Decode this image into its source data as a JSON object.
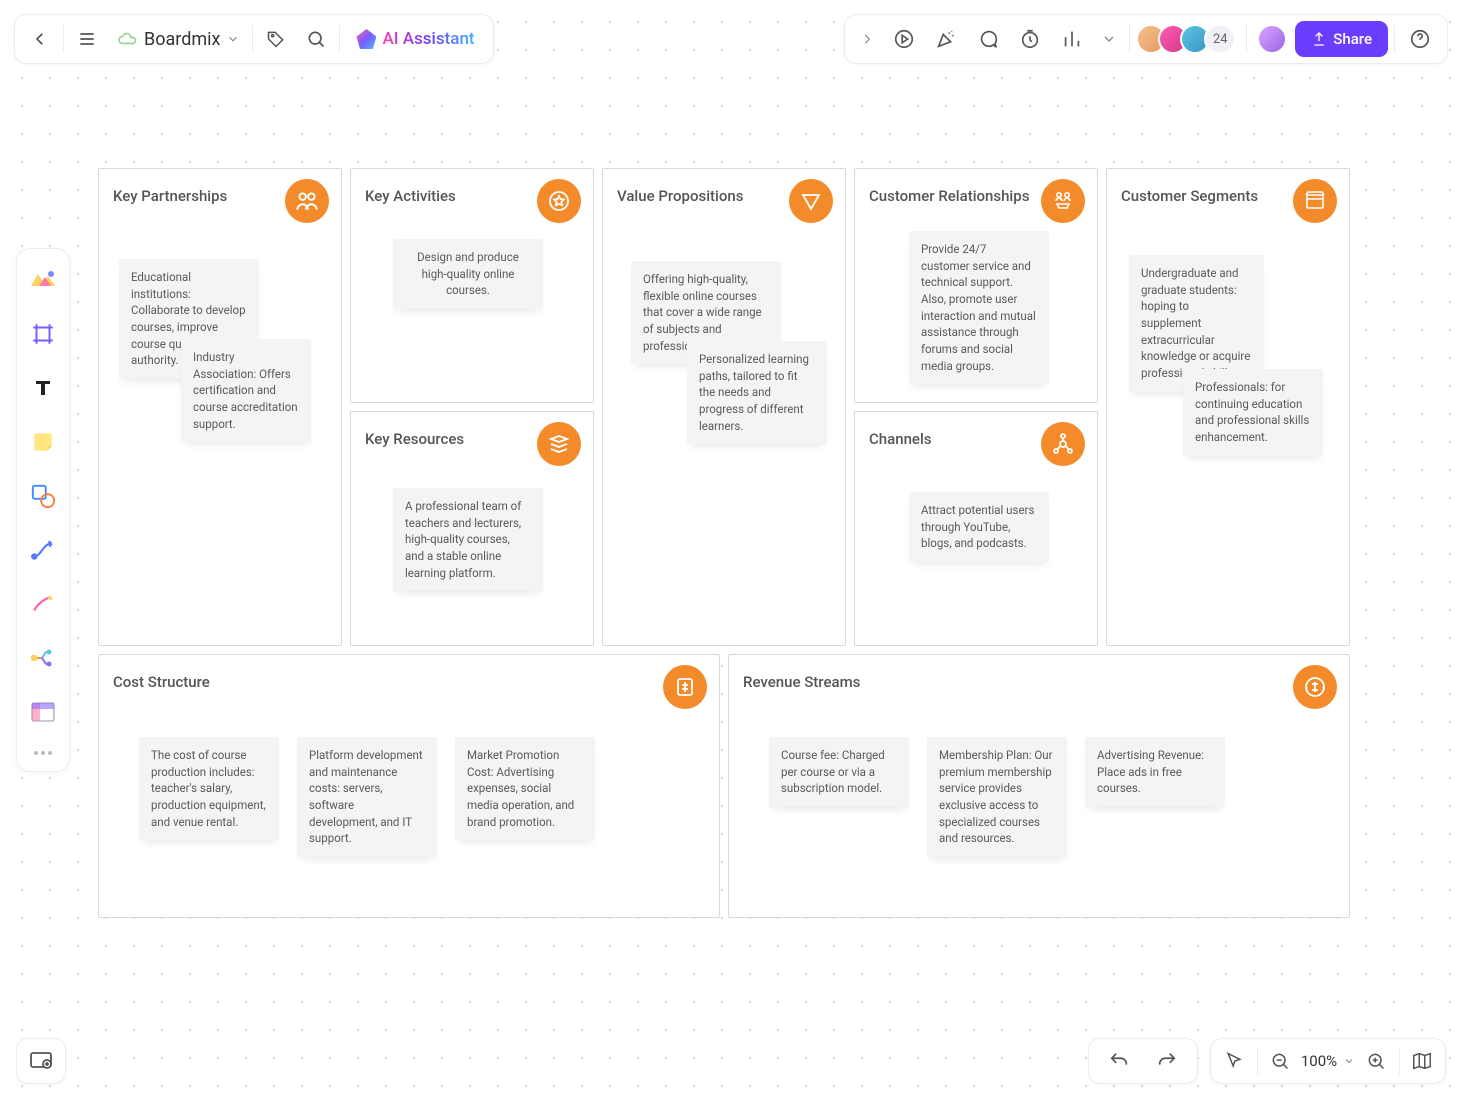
{
  "header": {
    "board_name": "Boardmix",
    "ai_label": "AI Assistant",
    "avatar_count": "24",
    "share_label": "Share"
  },
  "bottom": {
    "zoom_label": "100%"
  },
  "bmc": {
    "top": [
      {
        "title": "Key Partnerships",
        "stickies": [
          "Educational institutions: Collaborate to develop courses, improve course quality and authority.",
          "Industry Association: Offers certification and course accreditation support."
        ]
      },
      {
        "col": [
          {
            "title": "Key Activities",
            "stickies": [
              "Design and produce high-quality online courses."
            ]
          },
          {
            "title": "Key Resources",
            "stickies": [
              "A professional team of teachers and lecturers, high-quality courses, and a stable online learning platform."
            ]
          }
        ]
      },
      {
        "title": "Value Propositions",
        "stickies": [
          "Offering high-quality, flexible online courses that cover a wide range of subjects and professional skills.",
          "Personalized learning paths, tailored to fit the needs and progress of different learners."
        ]
      },
      {
        "col": [
          {
            "title": "Customer Relationships",
            "stickies": [
              "Provide 24/7 customer service and technical support. Also, promote user interaction and mutual assistance through forums and social media groups."
            ]
          },
          {
            "title": "Channels",
            "stickies": [
              "Attract potential users through YouTube, blogs, and podcasts."
            ]
          }
        ]
      },
      {
        "title": "Customer Segments",
        "stickies": [
          "Undergraduate and graduate students: hoping to supplement extracurricular knowledge or acquire professional skills.",
          "Professionals: for continuing education and professional skills enhancement."
        ]
      }
    ],
    "bottom": [
      {
        "title": "Cost Structure",
        "stickies": [
          "The cost of course production includes: teacher's salary, production equipment, and venue rental.",
          "Platform development and maintenance costs: servers, software development, and IT support.",
          "Market Promotion Cost: Advertising expenses, social media operation, and brand promotion."
        ]
      },
      {
        "title": "Revenue Streams",
        "stickies": [
          "Course fee: Charged per course or via a subscription model.",
          "Membership Plan: Our premium membership service provides exclusive access to specialized courses and resources.",
          "Advertising Revenue: Place ads in free courses."
        ]
      }
    ]
  }
}
